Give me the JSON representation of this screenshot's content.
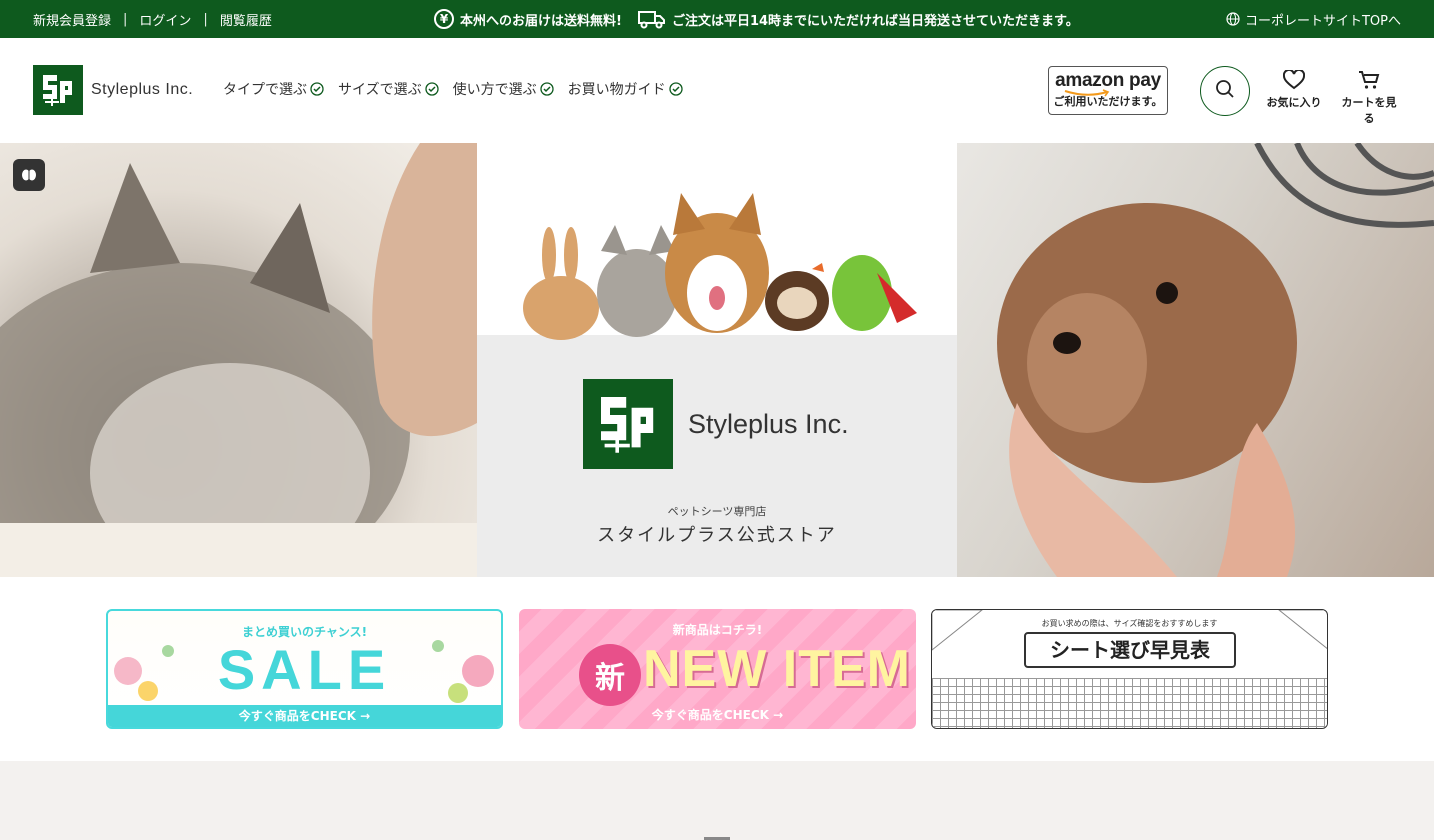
{
  "topbar": {
    "register": "新規会員登録",
    "login": "ログイン",
    "history": "閲覧履歴",
    "separator": "|",
    "yen_icon_text": "¥",
    "free_shipping": "本州へのお届けは送料無料!",
    "same_day": "ご注文は平日14時までにいただければ当日発送させていただきます。",
    "corporate": "コーポレートサイトTOPへ"
  },
  "header": {
    "logo_text": "Styleplus Inc.",
    "nav": [
      {
        "label": "タイプで選ぶ"
      },
      {
        "label": "サイズで選ぶ"
      },
      {
        "label": "使い方で選ぶ"
      },
      {
        "label": "お買い物ガイド"
      }
    ],
    "amazon_title": "amazon pay",
    "amazon_sub": "ご利用いただけます。",
    "favorites": "お気に入り",
    "cart": "カートを見る"
  },
  "hero": {
    "brand": "Styleplus Inc.",
    "subtitle": "ペットシーツ専門店",
    "title": "スタイルプラス公式ストア"
  },
  "banners": {
    "sale": {
      "sub": "まとめ買いのチャンス!",
      "big": "SALE",
      "cta": "今すぐ商品をCHECK →"
    },
    "new": {
      "sub": "新商品はコチラ!",
      "badge": "新",
      "big": "NEW ITEM",
      "cta": "今すぐ商品をCHECK →"
    },
    "size": {
      "sub": "お買い求めの際は、サイズ確認をおすすめします",
      "title": "シート選び早見表"
    }
  },
  "colors": {
    "brand_green": "#0e5a1e",
    "sale_cyan": "#45d6d9",
    "new_pink": "#ffb0cc"
  }
}
